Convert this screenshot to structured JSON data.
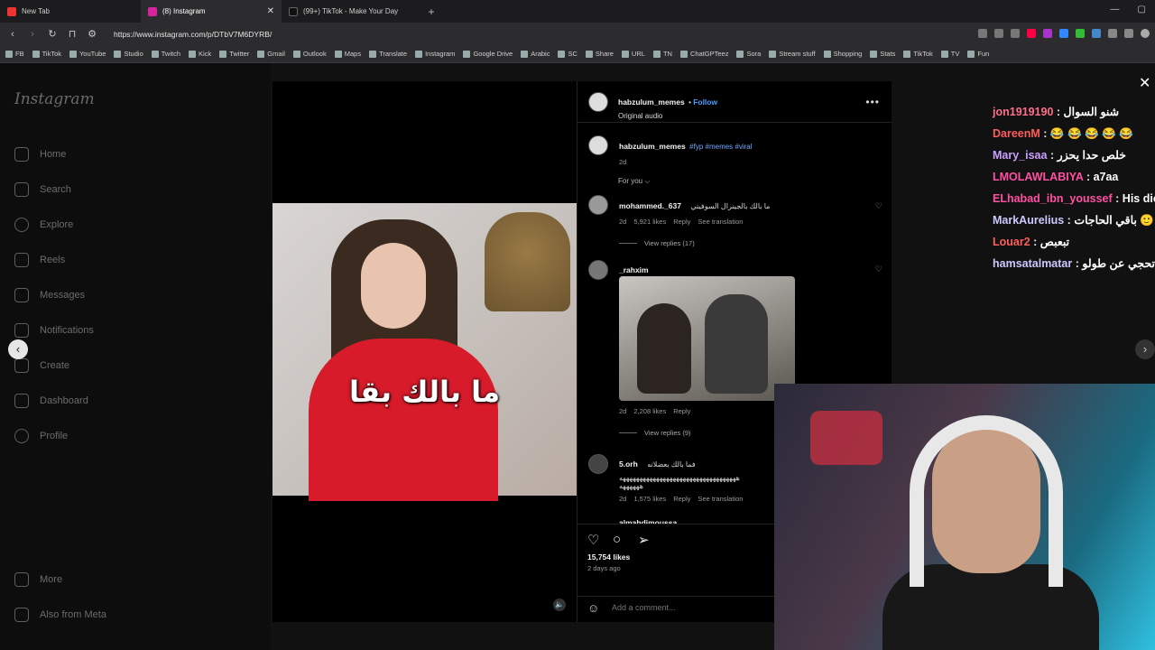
{
  "browser": {
    "tabs": [
      {
        "title": "New Tab",
        "color": "#e33"
      },
      {
        "title": "(8) Instagram",
        "color": "#d6249f"
      },
      {
        "title": "(99+) TikTok - Make Your Day",
        "color": "#111"
      }
    ],
    "url": "https://www.instagram.com/p/DTbV7M6DYRB/",
    "bookmarks": [
      "FB",
      "TikTok",
      "YouTube",
      "Studio",
      "Twitch",
      "Kick",
      "Twitter",
      "Gmail",
      "Outlook",
      "Maps",
      "Translate",
      "Instagram",
      "Google Drive",
      "Arabic",
      "SC",
      "Share",
      "URL",
      "TN",
      "ChatGPTeez",
      "Sora",
      "Stream stuff",
      "Shopping",
      "Stats",
      "TikTok",
      "TV",
      "Fun"
    ]
  },
  "instagram": {
    "logo": "Instagram",
    "nav": [
      {
        "label": "Home",
        "icon": "home-icon"
      },
      {
        "label": "Search",
        "icon": "search-icon"
      },
      {
        "label": "Explore",
        "icon": "explore-icon"
      },
      {
        "label": "Reels",
        "icon": "reels-icon"
      },
      {
        "label": "Messages",
        "icon": "messages-icon"
      },
      {
        "label": "Notifications",
        "icon": "heart-icon"
      },
      {
        "label": "Create",
        "icon": "plus-icon"
      },
      {
        "label": "Dashboard",
        "icon": "dashboard-icon"
      },
      {
        "label": "Profile",
        "icon": "avatar"
      },
      {
        "label": "More",
        "icon": "menu-icon"
      },
      {
        "label": "Also from Meta",
        "icon": "meta-icon"
      }
    ],
    "post": {
      "caption_overlay": "ما بالك بقا",
      "author": "habzulum_memes",
      "follow": "Follow",
      "audio": "Original audio",
      "caption_user": "habzulum_memes",
      "caption_tags": "#fyp #memes #viral",
      "caption_time": "2d",
      "sort": "For you",
      "likes": "15,754 likes",
      "date": "2 days ago",
      "add_comment": "Add a comment..."
    },
    "comments": [
      {
        "user": "mohammed._637",
        "text": "ما بالك بالجينرال السوفيتي",
        "time": "2d",
        "likes": "5,921 likes",
        "reply": "Reply",
        "translation": "See translation",
        "view_replies": "View replies (17)"
      },
      {
        "user": "_rahxim",
        "text": "",
        "time": "2d",
        "likes": "2,208 likes",
        "reply": "Reply",
        "view_replies": "View replies (9)"
      },
      {
        "user": "5.orh",
        "text": "فما بالك بعضلاته",
        "text2": "هههههههههههههههههههههههههههههههههههه",
        "text3": "ههههههه",
        "time": "2d",
        "likes": "1,575 likes",
        "reply": "Reply",
        "translation": "See translation"
      }
    ],
    "next_comment_user": "almahdimoussa"
  },
  "chat": [
    {
      "user": "jon1919190",
      "msg": "شنو السوال",
      "color": "#ff6f8a"
    },
    {
      "user": "DareenM",
      "msg": "😂 😂 😂 😂 😂",
      "color": "#ff5c5c"
    },
    {
      "user": "Mary_isaa",
      "msg": "خلص حدا يحزر",
      "color": "#c9a0ff"
    },
    {
      "user": "LMOLAWLABIYA",
      "msg": "a7aa",
      "color": "#ff4fa3"
    },
    {
      "user": "ELhabad_ibn_youssef",
      "msg": "His dick",
      "color": "#ff4fa3"
    },
    {
      "user": "MarkAurelius",
      "msg": "باقي الحاجات 🙂",
      "color": "#c9c9ff"
    },
    {
      "user": "Louar2",
      "msg": "تبعبص",
      "color": "#ff5c5c"
    },
    {
      "user": "hamsatalmatar",
      "msg": "اكو 😂😂😂 مقطع تحجي عن طولو 😂",
      "color": "#c9c9ff"
    }
  ]
}
